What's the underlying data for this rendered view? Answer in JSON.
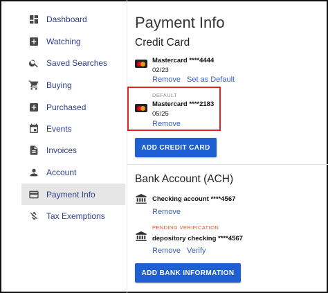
{
  "sidebar": {
    "items": [
      {
        "label": "Dashboard",
        "icon": "dashboard-icon"
      },
      {
        "label": "Watching",
        "icon": "add-box-icon"
      },
      {
        "label": "Saved Searches",
        "icon": "search-icon"
      },
      {
        "label": "Buying",
        "icon": "cart-icon"
      },
      {
        "label": "Purchased",
        "icon": "add-box-icon"
      },
      {
        "label": "Events",
        "icon": "calendar-icon"
      },
      {
        "label": "Invoices",
        "icon": "document-icon"
      },
      {
        "label": "Account",
        "icon": "person-icon"
      },
      {
        "label": "Payment Info",
        "icon": "credit-card-icon",
        "active": true
      },
      {
        "label": "Tax Exemptions",
        "icon": "no-dollar-icon"
      }
    ]
  },
  "main": {
    "title": "Payment Info",
    "credit_card": {
      "heading": "Credit Card",
      "cards": [
        {
          "name": "Mastercard ****4444",
          "expiry": "02/23",
          "remove_label": "Remove",
          "default_action_label": "Set as Default"
        },
        {
          "tag": "DEFAULT",
          "name": "Mastercard ****2183",
          "expiry": "05/25",
          "remove_label": "Remove"
        }
      ],
      "add_button": "ADD CREDIT CARD"
    },
    "bank": {
      "heading": "Bank Account (ACH)",
      "accounts": [
        {
          "name": "Checking account ****4567",
          "remove_label": "Remove"
        },
        {
          "tag": "PENDING VERIFICATION",
          "name": "depository checking ****4567",
          "remove_label": "Remove",
          "verify_label": "Verify"
        }
      ],
      "add_button": "ADD BANK INFORMATION"
    }
  },
  "colors": {
    "accent": "#1f5fd1",
    "link": "#3a5fb5",
    "nav_text": "#2d3e8a",
    "highlight": "#e02323",
    "pending": "#d35b2a"
  }
}
